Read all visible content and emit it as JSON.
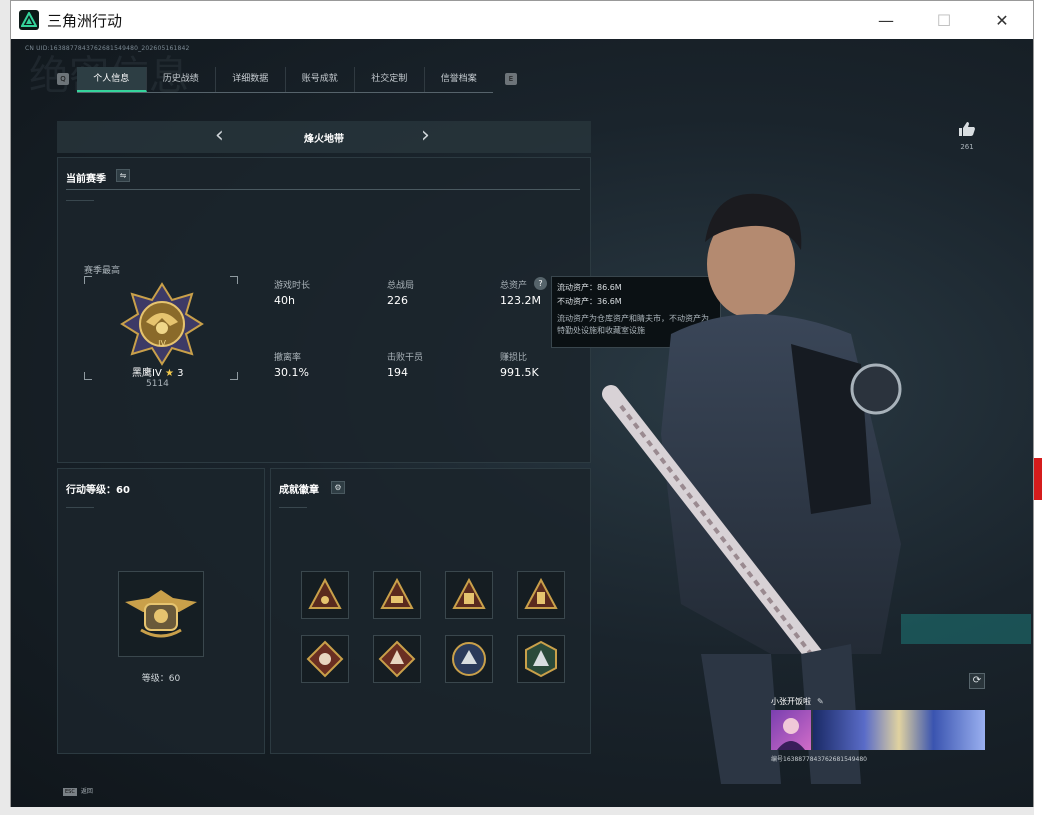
{
  "window": {
    "title": "三角洲行动",
    "minimize": "—",
    "maximize": "☐",
    "close": "✕"
  },
  "header": {
    "uid": "CN UID:1638877843762681549480_202605161842",
    "ghost": "绝密信息"
  },
  "tabs": [
    {
      "label": "个人信息",
      "active": true
    },
    {
      "label": "历史战绩",
      "active": false
    },
    {
      "label": "详细数据",
      "active": false
    },
    {
      "label": "账号成就",
      "active": false
    },
    {
      "label": "社交定制",
      "active": false
    },
    {
      "label": "信誉档案",
      "active": false
    }
  ],
  "keys": {
    "left": "Q",
    "right": "E"
  },
  "mode_selector": {
    "label": "烽火地带",
    "prev": "‹",
    "next": "›"
  },
  "season": {
    "title": "当前赛季",
    "swap_icon": "⇋",
    "best_label": "赛季最高",
    "rank_name": "黑鹰IV",
    "star_icon": "★",
    "stars": "3",
    "score": "5114",
    "stats": [
      {
        "label": "游戏时长",
        "value": "40h"
      },
      {
        "label": "总战局",
        "value": "226"
      },
      {
        "label": "总资产",
        "value": "123.2M"
      },
      {
        "label": "撤离率",
        "value": "30.1%"
      },
      {
        "label": "击败干员",
        "value": "194"
      },
      {
        "label": "赚损比",
        "value": "991.5K"
      }
    ],
    "help_icon": "?"
  },
  "tooltip": {
    "line1": "流动资产：86.6M",
    "line2": "不动资产：36.6M",
    "desc": "流动资产为仓库资产和睛夫市，不动资产为特勤处设施和收藏室设施"
  },
  "level": {
    "title": "行动等级：60",
    "caption": "等级：60"
  },
  "badges": {
    "title": "成就徽章",
    "gear_icon": "⚙",
    "count": 8
  },
  "like": {
    "count": "261",
    "icon": "thumbs-up-icon"
  },
  "profile": {
    "name": "小张开饭啦",
    "edit_icon": "✎",
    "id": "编号1638877843762681549480"
  },
  "refresh_icon": "⟳",
  "esc": {
    "key": "ESC",
    "label": "返回"
  },
  "colors": {
    "accent": "#35d49c",
    "gold": "#c9a04a",
    "panel": "#1b252b"
  }
}
